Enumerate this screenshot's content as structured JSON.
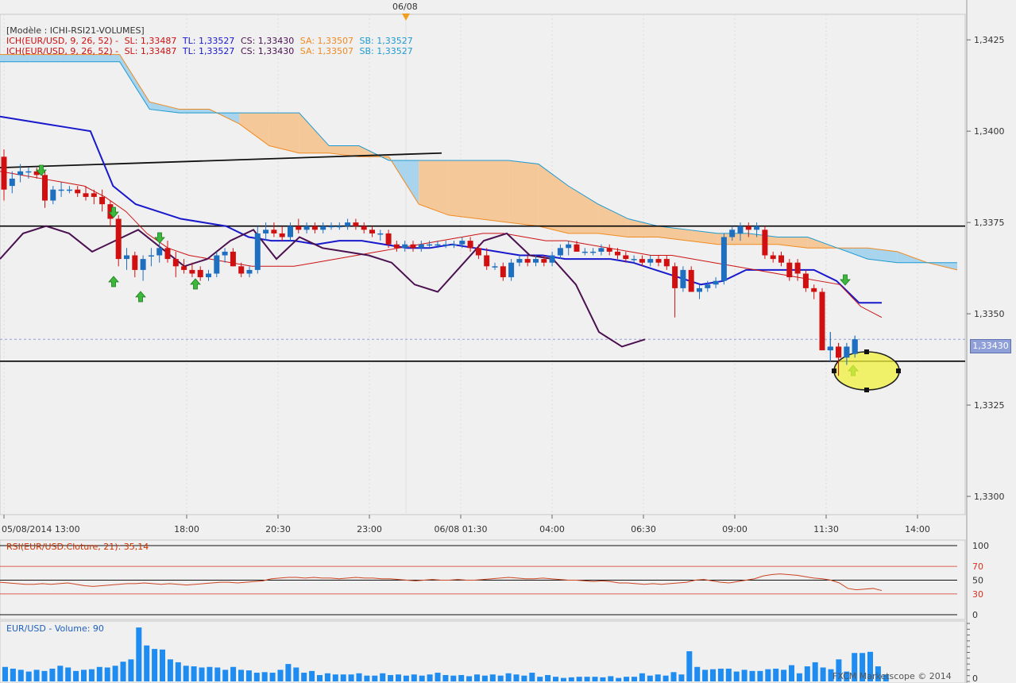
{
  "date_marker": "06/08",
  "legend": {
    "model": "[Modèle : ICHI-RSI21-VOLUMES]",
    "lines": [
      {
        "ich": "ICH(EUR/USD, 9, 26, 52) -",
        "sl": "SL: 1,33487",
        "tl": "TL: 1,33527",
        "cs": "CS: 1,33430",
        "sa": "SA: 1,33507",
        "sb": "SB: 1,33527"
      },
      {
        "ich": "ICH(EUR/USD, 9, 26, 52) -",
        "sl": "SL: 1,33487",
        "tl": "TL: 1,33527",
        "cs": "CS: 1,33430",
        "sa": "SA: 1,33507",
        "sb": "SB: 1,33527"
      }
    ]
  },
  "colors": {
    "up": "#1f6fc0",
    "down": "#d01010",
    "kumo_bull": "#a8d4ee",
    "kumo_bear": "#f5c89a",
    "tenkan": "#cc1010",
    "kijun": "#1818cc",
    "chikou": "#4a1050",
    "rsi": "#cc4422",
    "volume": "#1e8cf0",
    "highlight": "#f2f23c"
  },
  "current_price_label": "1,33430",
  "rsi_label": "RSI(EUR/USD.Cloture, 21): 35,14",
  "volume_label": "EUR/USD - Volume: 90",
  "copyright": "FXCM Marketscope © 2014",
  "chart_data": [
    {
      "type": "candlestick",
      "title": "",
      "ylim": [
        1.3295,
        1.3432
      ],
      "y_ticks": [
        "1,3425",
        "1,3400",
        "1,3375",
        "1,3350",
        "1,3325",
        "1,3300"
      ],
      "x_ticks": [
        "05/08/2014 13:00",
        "18:00",
        "20:30",
        "23:00",
        "06/08 01:30",
        "04:00",
        "06:30",
        "09:00",
        "11:30",
        "14:00"
      ],
      "candles": [
        {
          "o": 1.3393,
          "h": 1.3395,
          "l": 1.3381,
          "c": 1.3384
        },
        {
          "o": 1.3385,
          "h": 1.3389,
          "l": 1.3383,
          "c": 1.3387
        },
        {
          "o": 1.3388,
          "h": 1.3391,
          "l": 1.3386,
          "c": 1.3389
        },
        {
          "o": 1.3389,
          "h": 1.339,
          "l": 1.3387,
          "c": 1.3389
        },
        {
          "o": 1.3389,
          "h": 1.339,
          "l": 1.3387,
          "c": 1.3388
        },
        {
          "o": 1.3388,
          "h": 1.3389,
          "l": 1.3379,
          "c": 1.3381
        },
        {
          "o": 1.3381,
          "h": 1.3385,
          "l": 1.338,
          "c": 1.3384
        },
        {
          "o": 1.3384,
          "h": 1.3386,
          "l": 1.3382,
          "c": 1.3384
        },
        {
          "o": 1.3384,
          "h": 1.3385,
          "l": 1.3383,
          "c": 1.3384
        },
        {
          "o": 1.3384,
          "h": 1.3385,
          "l": 1.3382,
          "c": 1.3383
        },
        {
          "o": 1.3383,
          "h": 1.3385,
          "l": 1.3381,
          "c": 1.3382
        },
        {
          "o": 1.3383,
          "h": 1.3384,
          "l": 1.338,
          "c": 1.3382
        },
        {
          "o": 1.3382,
          "h": 1.3384,
          "l": 1.3378,
          "c": 1.338
        },
        {
          "o": 1.338,
          "h": 1.3381,
          "l": 1.3374,
          "c": 1.3376
        },
        {
          "o": 1.3376,
          "h": 1.3377,
          "l": 1.3363,
          "c": 1.3365
        },
        {
          "o": 1.3365,
          "h": 1.3368,
          "l": 1.3362,
          "c": 1.3366
        },
        {
          "o": 1.3366,
          "h": 1.3367,
          "l": 1.336,
          "c": 1.3362
        },
        {
          "o": 1.3362,
          "h": 1.3366,
          "l": 1.3359,
          "c": 1.3365
        },
        {
          "o": 1.3366,
          "h": 1.3368,
          "l": 1.3363,
          "c": 1.3366
        },
        {
          "o": 1.3366,
          "h": 1.337,
          "l": 1.3364,
          "c": 1.3368
        },
        {
          "o": 1.3368,
          "h": 1.337,
          "l": 1.3364,
          "c": 1.3365
        },
        {
          "o": 1.3365,
          "h": 1.3367,
          "l": 1.336,
          "c": 1.3363
        },
        {
          "o": 1.3363,
          "h": 1.3365,
          "l": 1.3361,
          "c": 1.3362
        },
        {
          "o": 1.3362,
          "h": 1.3364,
          "l": 1.336,
          "c": 1.3361
        },
        {
          "o": 1.3362,
          "h": 1.3363,
          "l": 1.3359,
          "c": 1.336
        },
        {
          "o": 1.336,
          "h": 1.3362,
          "l": 1.3359,
          "c": 1.3361
        },
        {
          "o": 1.3361,
          "h": 1.3367,
          "l": 1.336,
          "c": 1.3366
        },
        {
          "o": 1.3366,
          "h": 1.3368,
          "l": 1.3364,
          "c": 1.3367
        },
        {
          "o": 1.3367,
          "h": 1.3368,
          "l": 1.3363,
          "c": 1.3363
        },
        {
          "o": 1.3363,
          "h": 1.3364,
          "l": 1.336,
          "c": 1.3361
        },
        {
          "o": 1.3361,
          "h": 1.3363,
          "l": 1.336,
          "c": 1.3362
        },
        {
          "o": 1.3362,
          "h": 1.3374,
          "l": 1.3361,
          "c": 1.3372
        },
        {
          "o": 1.3372,
          "h": 1.3375,
          "l": 1.337,
          "c": 1.3373
        },
        {
          "o": 1.3373,
          "h": 1.3375,
          "l": 1.3371,
          "c": 1.3372
        },
        {
          "o": 1.3372,
          "h": 1.3374,
          "l": 1.337,
          "c": 1.3371
        },
        {
          "o": 1.3371,
          "h": 1.3375,
          "l": 1.337,
          "c": 1.3374
        },
        {
          "o": 1.3374,
          "h": 1.3376,
          "l": 1.3372,
          "c": 1.3373
        },
        {
          "o": 1.3373,
          "h": 1.3375,
          "l": 1.3372,
          "c": 1.3374
        },
        {
          "o": 1.3374,
          "h": 1.3375,
          "l": 1.3372,
          "c": 1.3373
        },
        {
          "o": 1.3373,
          "h": 1.3375,
          "l": 1.3372,
          "c": 1.3374
        },
        {
          "o": 1.3374,
          "h": 1.3375,
          "l": 1.3373,
          "c": 1.3374
        },
        {
          "o": 1.3374,
          "h": 1.3375,
          "l": 1.3373,
          "c": 1.3374
        },
        {
          "o": 1.3374,
          "h": 1.3376,
          "l": 1.3373,
          "c": 1.3375
        },
        {
          "o": 1.3375,
          "h": 1.3376,
          "l": 1.3373,
          "c": 1.3374
        },
        {
          "o": 1.3374,
          "h": 1.3375,
          "l": 1.3372,
          "c": 1.3373
        },
        {
          "o": 1.3373,
          "h": 1.3374,
          "l": 1.3371,
          "c": 1.3372
        },
        {
          "o": 1.3372,
          "h": 1.3373,
          "l": 1.337,
          "c": 1.3372
        },
        {
          "o": 1.3372,
          "h": 1.3373,
          "l": 1.3368,
          "c": 1.3369
        },
        {
          "o": 1.3369,
          "h": 1.337,
          "l": 1.3367,
          "c": 1.3368
        },
        {
          "o": 1.3368,
          "h": 1.337,
          "l": 1.3367,
          "c": 1.3369
        },
        {
          "o": 1.3369,
          "h": 1.337,
          "l": 1.3367,
          "c": 1.3368
        },
        {
          "o": 1.3368,
          "h": 1.337,
          "l": 1.3367,
          "c": 1.3369
        },
        {
          "o": 1.3369,
          "h": 1.337,
          "l": 1.3368,
          "c": 1.3369
        },
        {
          "o": 1.3369,
          "h": 1.337,
          "l": 1.3368,
          "c": 1.3369
        },
        {
          "o": 1.3369,
          "h": 1.337,
          "l": 1.3368,
          "c": 1.3369
        },
        {
          "o": 1.3369,
          "h": 1.337,
          "l": 1.3368,
          "c": 1.3369
        },
        {
          "o": 1.3369,
          "h": 1.3371,
          "l": 1.3368,
          "c": 1.337
        },
        {
          "o": 1.337,
          "h": 1.3371,
          "l": 1.3367,
          "c": 1.3368
        },
        {
          "o": 1.3368,
          "h": 1.3369,
          "l": 1.3365,
          "c": 1.3366
        },
        {
          "o": 1.3366,
          "h": 1.3368,
          "l": 1.3362,
          "c": 1.3363
        },
        {
          "o": 1.3363,
          "h": 1.3364,
          "l": 1.3362,
          "c": 1.3363
        },
        {
          "o": 1.3363,
          "h": 1.3364,
          "l": 1.3359,
          "c": 1.336
        },
        {
          "o": 1.336,
          "h": 1.3365,
          "l": 1.3359,
          "c": 1.3364
        },
        {
          "o": 1.3364,
          "h": 1.3366,
          "l": 1.3363,
          "c": 1.3365
        },
        {
          "o": 1.3365,
          "h": 1.3366,
          "l": 1.3363,
          "c": 1.3364
        },
        {
          "o": 1.3364,
          "h": 1.3366,
          "l": 1.3363,
          "c": 1.3365
        },
        {
          "o": 1.3365,
          "h": 1.3366,
          "l": 1.3363,
          "c": 1.3364
        },
        {
          "o": 1.3364,
          "h": 1.3367,
          "l": 1.3363,
          "c": 1.3366
        },
        {
          "o": 1.3366,
          "h": 1.3369,
          "l": 1.3365,
          "c": 1.3368
        },
        {
          "o": 1.3368,
          "h": 1.337,
          "l": 1.3366,
          "c": 1.3369
        },
        {
          "o": 1.3369,
          "h": 1.337,
          "l": 1.3367,
          "c": 1.3367
        },
        {
          "o": 1.3367,
          "h": 1.3368,
          "l": 1.3366,
          "c": 1.3367
        },
        {
          "o": 1.3367,
          "h": 1.3368,
          "l": 1.3366,
          "c": 1.3367
        },
        {
          "o": 1.3367,
          "h": 1.3369,
          "l": 1.3366,
          "c": 1.3368
        },
        {
          "o": 1.3368,
          "h": 1.3369,
          "l": 1.3366,
          "c": 1.3367
        },
        {
          "o": 1.3367,
          "h": 1.3368,
          "l": 1.3365,
          "c": 1.3366
        },
        {
          "o": 1.3366,
          "h": 1.3367,
          "l": 1.3364,
          "c": 1.3365
        },
        {
          "o": 1.3365,
          "h": 1.3366,
          "l": 1.3364,
          "c": 1.3365
        },
        {
          "o": 1.3365,
          "h": 1.3366,
          "l": 1.3363,
          "c": 1.3364
        },
        {
          "o": 1.3364,
          "h": 1.3366,
          "l": 1.3363,
          "c": 1.3365
        },
        {
          "o": 1.3365,
          "h": 1.3366,
          "l": 1.3363,
          "c": 1.3364
        },
        {
          "o": 1.3365,
          "h": 1.3366,
          "l": 1.3362,
          "c": 1.3363
        },
        {
          "o": 1.3363,
          "h": 1.3364,
          "l": 1.3349,
          "c": 1.3357
        },
        {
          "o": 1.3357,
          "h": 1.3363,
          "l": 1.3356,
          "c": 1.3362
        },
        {
          "o": 1.3362,
          "h": 1.3363,
          "l": 1.3356,
          "c": 1.3356
        },
        {
          "o": 1.3356,
          "h": 1.3358,
          "l": 1.3354,
          "c": 1.3357
        },
        {
          "o": 1.3357,
          "h": 1.3359,
          "l": 1.3356,
          "c": 1.3358
        },
        {
          "o": 1.3358,
          "h": 1.336,
          "l": 1.3357,
          "c": 1.3359
        },
        {
          "o": 1.3359,
          "h": 1.3372,
          "l": 1.3358,
          "c": 1.3371
        },
        {
          "o": 1.3371,
          "h": 1.3374,
          "l": 1.337,
          "c": 1.3373
        },
        {
          "o": 1.3372,
          "h": 1.3375,
          "l": 1.337,
          "c": 1.3374
        },
        {
          "o": 1.3374,
          "h": 1.3375,
          "l": 1.3371,
          "c": 1.3373
        },
        {
          "o": 1.3373,
          "h": 1.3375,
          "l": 1.3371,
          "c": 1.3374
        },
        {
          "o": 1.3373,
          "h": 1.3374,
          "l": 1.3365,
          "c": 1.3366
        },
        {
          "o": 1.3366,
          "h": 1.3367,
          "l": 1.3364,
          "c": 1.3365
        },
        {
          "o": 1.3366,
          "h": 1.3367,
          "l": 1.3363,
          "c": 1.3364
        },
        {
          "o": 1.3364,
          "h": 1.3365,
          "l": 1.3359,
          "c": 1.336
        },
        {
          "o": 1.3364,
          "h": 1.3365,
          "l": 1.3359,
          "c": 1.3361
        },
        {
          "o": 1.3361,
          "h": 1.3362,
          "l": 1.3356,
          "c": 1.3357
        },
        {
          "o": 1.3357,
          "h": 1.3358,
          "l": 1.3354,
          "c": 1.3356
        },
        {
          "o": 1.3356,
          "h": 1.3357,
          "l": 1.334,
          "c": 1.334
        },
        {
          "o": 1.334,
          "h": 1.3345,
          "l": 1.3337,
          "c": 1.3341
        },
        {
          "o": 1.3341,
          "h": 1.3342,
          "l": 1.3333,
          "c": 1.3338
        },
        {
          "o": 1.3338,
          "h": 1.3342,
          "l": 1.3336,
          "c": 1.3341
        },
        {
          "o": 1.3339,
          "h": 1.3344,
          "l": 1.3338,
          "c": 1.3343
        }
      ],
      "tenkan_sen": [
        1.3389,
        1.3388,
        1.3387,
        1.3386,
        1.3385,
        1.3382,
        1.3378,
        1.3372,
        1.3368,
        1.3366,
        1.3365,
        1.3364,
        1.3363,
        1.3363,
        1.3363,
        1.3364,
        1.3365,
        1.3366,
        1.3367,
        1.3368,
        1.3369,
        1.337,
        1.3371,
        1.3372,
        1.3372,
        1.3371,
        1.337,
        1.337,
        1.3369,
        1.3368,
        1.3367,
        1.3366,
        1.3366,
        1.3365,
        1.3364,
        1.3363,
        1.3362,
        1.3361,
        1.336,
        1.3359,
        1.3358,
        1.3352,
        1.3349
      ],
      "kijun_sen": [
        1.3404,
        1.3403,
        1.3402,
        1.3401,
        1.34,
        1.3385,
        1.338,
        1.3378,
        1.3376,
        1.3375,
        1.3374,
        1.3371,
        1.337,
        1.337,
        1.3369,
        1.337,
        1.337,
        1.3369,
        1.3368,
        1.3368,
        1.3369,
        1.3368,
        1.3367,
        1.3366,
        1.3366,
        1.3365,
        1.3365,
        1.3365,
        1.3364,
        1.3362,
        1.336,
        1.3358,
        1.3359,
        1.3362,
        1.3362,
        1.3362,
        1.3362,
        1.3359,
        1.3353,
        1.3353
      ],
      "chikou_span": [
        1.3365,
        1.3372,
        1.3374,
        1.3372,
        1.3367,
        1.337,
        1.3373,
        1.3368,
        1.3363,
        1.3365,
        1.337,
        1.3373,
        1.3365,
        1.3371,
        1.3368,
        1.3367,
        1.3366,
        1.3364,
        1.3358,
        1.3356,
        1.3363,
        1.337,
        1.3372,
        1.3366,
        1.3365,
        1.3358,
        1.3345,
        1.3341,
        1.3343
      ],
      "senkou_a": [
        1.3421,
        1.3421,
        1.3421,
        1.3421,
        1.3421,
        1.3408,
        1.3406,
        1.3406,
        1.3402,
        1.3396,
        1.3394,
        1.3394,
        1.3393,
        1.3393,
        1.338,
        1.3377,
        1.3376,
        1.3375,
        1.3374,
        1.3372,
        1.3372,
        1.3371,
        1.3371,
        1.337,
        1.3369,
        1.3369,
        1.3369,
        1.3368,
        1.3368,
        1.3368,
        1.3367,
        1.3364,
        1.3362
      ],
      "senkou_b": [
        1.3419,
        1.3419,
        1.3419,
        1.3419,
        1.3419,
        1.3406,
        1.3405,
        1.3405,
        1.3405,
        1.3405,
        1.3405,
        1.3396,
        1.3396,
        1.3392,
        1.3392,
        1.3392,
        1.3392,
        1.3392,
        1.3391,
        1.3385,
        1.338,
        1.3376,
        1.3374,
        1.3373,
        1.3372,
        1.3372,
        1.3371,
        1.3371,
        1.3368,
        1.3365,
        1.3364,
        1.3364,
        1.3364
      ],
      "horizontal_levels": [
        1.3374,
        1.3337
      ],
      "trend_line": [
        1.339,
        1.3394
      ],
      "signal_arrows": [
        "down",
        "down",
        "up",
        "up",
        "down",
        "up",
        "up",
        "down",
        "up"
      ]
    },
    {
      "type": "line",
      "title": "RSI(EUR/USD.Cloture, 21): 35,14",
      "ylim": [
        0,
        100
      ],
      "y_ticks": [
        "100",
        "70",
        "50",
        "30",
        "0"
      ],
      "levels": [
        100,
        70,
        50,
        30,
        0
      ],
      "values": [
        47,
        46,
        45,
        44,
        44,
        45,
        44,
        45,
        46,
        44,
        42,
        41,
        42,
        43,
        44,
        45,
        45,
        46,
        45,
        44,
        45,
        44,
        43,
        44,
        45,
        46,
        47,
        47,
        46,
        47,
        48,
        49,
        52,
        53,
        54,
        54,
        53,
        54,
        53,
        53,
        52,
        53,
        54,
        53,
        53,
        52,
        52,
        51,
        50,
        49,
        50,
        51,
        50,
        50,
        51,
        50,
        50,
        51,
        52,
        53,
        54,
        53,
        52,
        52,
        53,
        52,
        51,
        50,
        50,
        49,
        48,
        49,
        48,
        46,
        46,
        45,
        44,
        45,
        44,
        45,
        46,
        47,
        50,
        51,
        49,
        47,
        46,
        48,
        50,
        52,
        56,
        58,
        59,
        58,
        57,
        55,
        53,
        52,
        50,
        46,
        38,
        36,
        37,
        38,
        35
      ]
    },
    {
      "type": "bar",
      "title": "EUR/USD - Volume: 90",
      "ylim": [
        0,
        100
      ],
      "y_ticks": [
        "100",
        "90",
        "80",
        "70",
        "60",
        "50",
        "40",
        "30",
        "20",
        "10",
        "0"
      ],
      "values": [
        25,
        22,
        20,
        17,
        20,
        18,
        22,
        27,
        24,
        18,
        20,
        21,
        25,
        24,
        27,
        34,
        38,
        93,
        62,
        56,
        55,
        38,
        33,
        27,
        26,
        24,
        25,
        24,
        20,
        25,
        20,
        19,
        15,
        16,
        15,
        20,
        30,
        24,
        15,
        18,
        11,
        14,
        12,
        12,
        12,
        14,
        10,
        10,
        14,
        11,
        12,
        10,
        12,
        10,
        12,
        15,
        11,
        10,
        11,
        9,
        12,
        10,
        12,
        10,
        14,
        12,
        10,
        15,
        8,
        11,
        8,
        6,
        7,
        8,
        8,
        8,
        7,
        9,
        6,
        8,
        8,
        14,
        10,
        12,
        10,
        16,
        12,
        52,
        25,
        20,
        21,
        22,
        22,
        17,
        20,
        18,
        18,
        21,
        22,
        20,
        28,
        14,
        26,
        33,
        24,
        21,
        38,
        17,
        49,
        49,
        51,
        26,
        12
      ]
    }
  ]
}
